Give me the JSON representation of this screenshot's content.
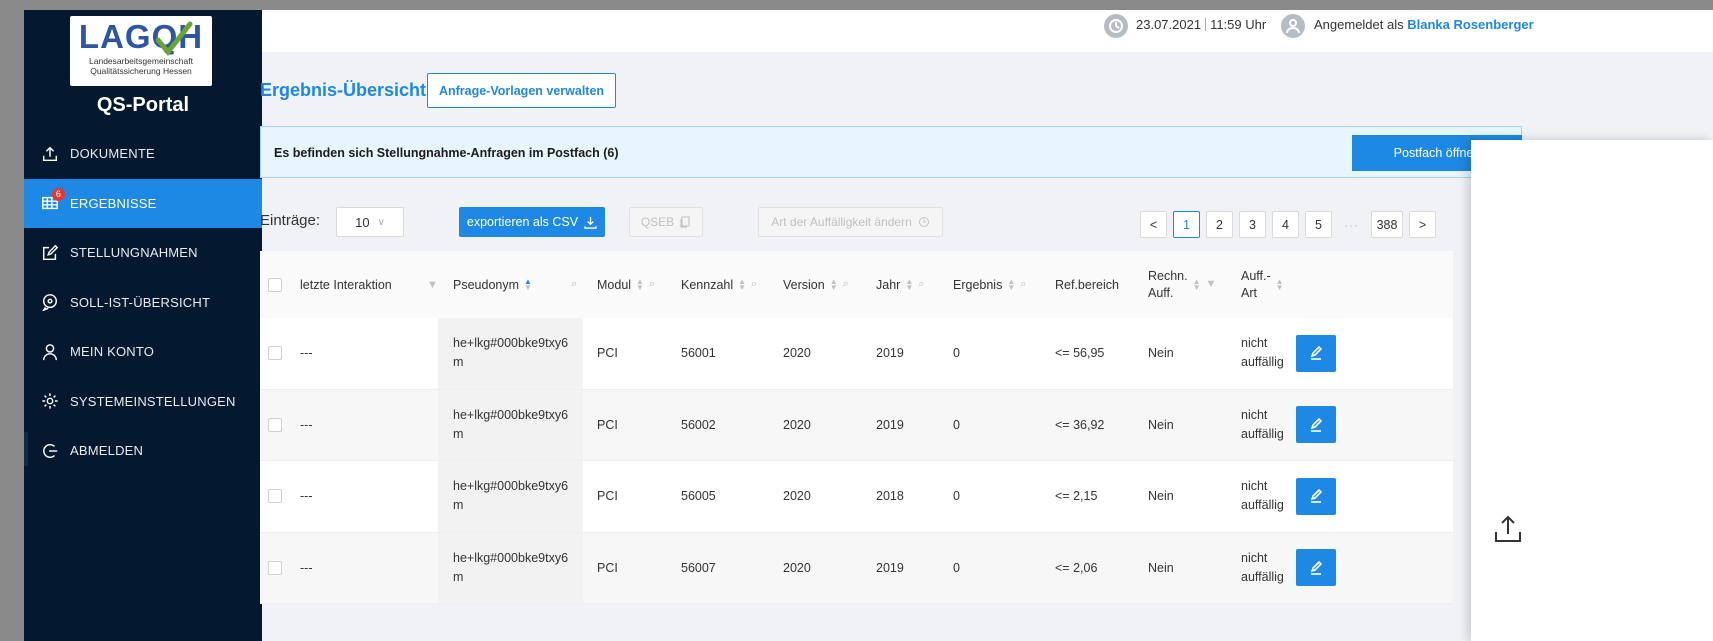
{
  "logo": {
    "word": "LAGQH",
    "sub1": "Landesarbeitsgemeinschaft",
    "sub2": "Qualitätssicherung Hessen"
  },
  "sidebar": {
    "title": "QS-Portal",
    "items": [
      {
        "label": "DOKUMENTE",
        "icon": "upload-icon"
      },
      {
        "label": "ERGEBNISSE",
        "icon": "grid-icon",
        "badge": "6",
        "active": true
      },
      {
        "label": "STELLUNGNAHMEN",
        "icon": "edit-square-icon"
      },
      {
        "label": "SOLL-IST-ÜBERSICHT",
        "icon": "chat-icon"
      },
      {
        "label": "MEIN KONTO",
        "icon": "user-icon"
      },
      {
        "label": "SYSTEMEINSTELLUNGEN",
        "icon": "gear-icon"
      },
      {
        "label": "ABMELDEN",
        "icon": "logout-icon"
      }
    ]
  },
  "header": {
    "date": "23.07.2021",
    "time": "11:59 Uhr",
    "logged_in_prefix": "Angemeldet als",
    "user_name": "Blanka Rosenberger"
  },
  "main": {
    "title": "Ergebnis-Übersicht",
    "manage_templates": "Anfrage-Vorlagen verwalten",
    "banner_text": "Es befinden sich Stellungnahme-Anfragen im Postfach (6)",
    "banner_button": "Postfach öffnen",
    "entries_label": "Einträge:",
    "entries_value": "10",
    "export_csv": "exportieren als CSV",
    "qseb": "QSEB",
    "change_type": "Art der Auffälligkeit ändern",
    "pagination": {
      "pages": [
        "1",
        "2",
        "3",
        "4",
        "5"
      ],
      "dots": "···",
      "last": "388",
      "prev": "<",
      "next": ">"
    }
  },
  "table": {
    "headers": {
      "interaction": "letzte Interaktion",
      "pseudonym": "Pseudonym",
      "modul": "Modul",
      "kennzahl": "Kennzahl",
      "version": "Version",
      "jahr": "Jahr",
      "ergebnis": "Ergebnis",
      "refbereich": "Ref.bereich",
      "rechn1": "Rechn.",
      "rechn2": "Auff.",
      "auff1": "Auff.-",
      "auff2": "Art"
    },
    "rows": [
      {
        "interaction": "---",
        "pseudo1": "he+lkg#000bke9txy6",
        "pseudo2": "m",
        "modul": "PCI",
        "kennzahl": "56001",
        "version": "2020",
        "jahr": "2019",
        "ergebnis": "0",
        "refbereich": "<= 56,95",
        "rechn": "Nein",
        "auff1": "nicht",
        "auff2": "auffällig"
      },
      {
        "interaction": "---",
        "pseudo1": "he+lkg#000bke9txy6",
        "pseudo2": "m",
        "modul": "PCI",
        "kennzahl": "56002",
        "version": "2020",
        "jahr": "2019",
        "ergebnis": "0",
        "refbereich": "<= 36,92",
        "rechn": "Nein",
        "auff1": "nicht",
        "auff2": "auffällig"
      },
      {
        "interaction": "---",
        "pseudo1": "he+lkg#000bke9txy6",
        "pseudo2": "m",
        "modul": "PCI",
        "kennzahl": "56005",
        "version": "2020",
        "jahr": "2018",
        "ergebnis": "0",
        "refbereich": "<= 2,15",
        "rechn": "Nein",
        "auff1": "nicht",
        "auff2": "auffällig"
      },
      {
        "interaction": "---",
        "pseudo1": "he+lkg#000bke9txy6",
        "pseudo2": "m",
        "modul": "PCI",
        "kennzahl": "56007",
        "version": "2020",
        "jahr": "2019",
        "ergebnis": "0",
        "refbereich": "<= 2,06",
        "rechn": "Nein",
        "auff1": "nicht",
        "auff2": "auffällig"
      }
    ]
  },
  "colors": {
    "accent": "#1e88e5",
    "sidebar": "#04192f",
    "badge": "#e53935"
  }
}
